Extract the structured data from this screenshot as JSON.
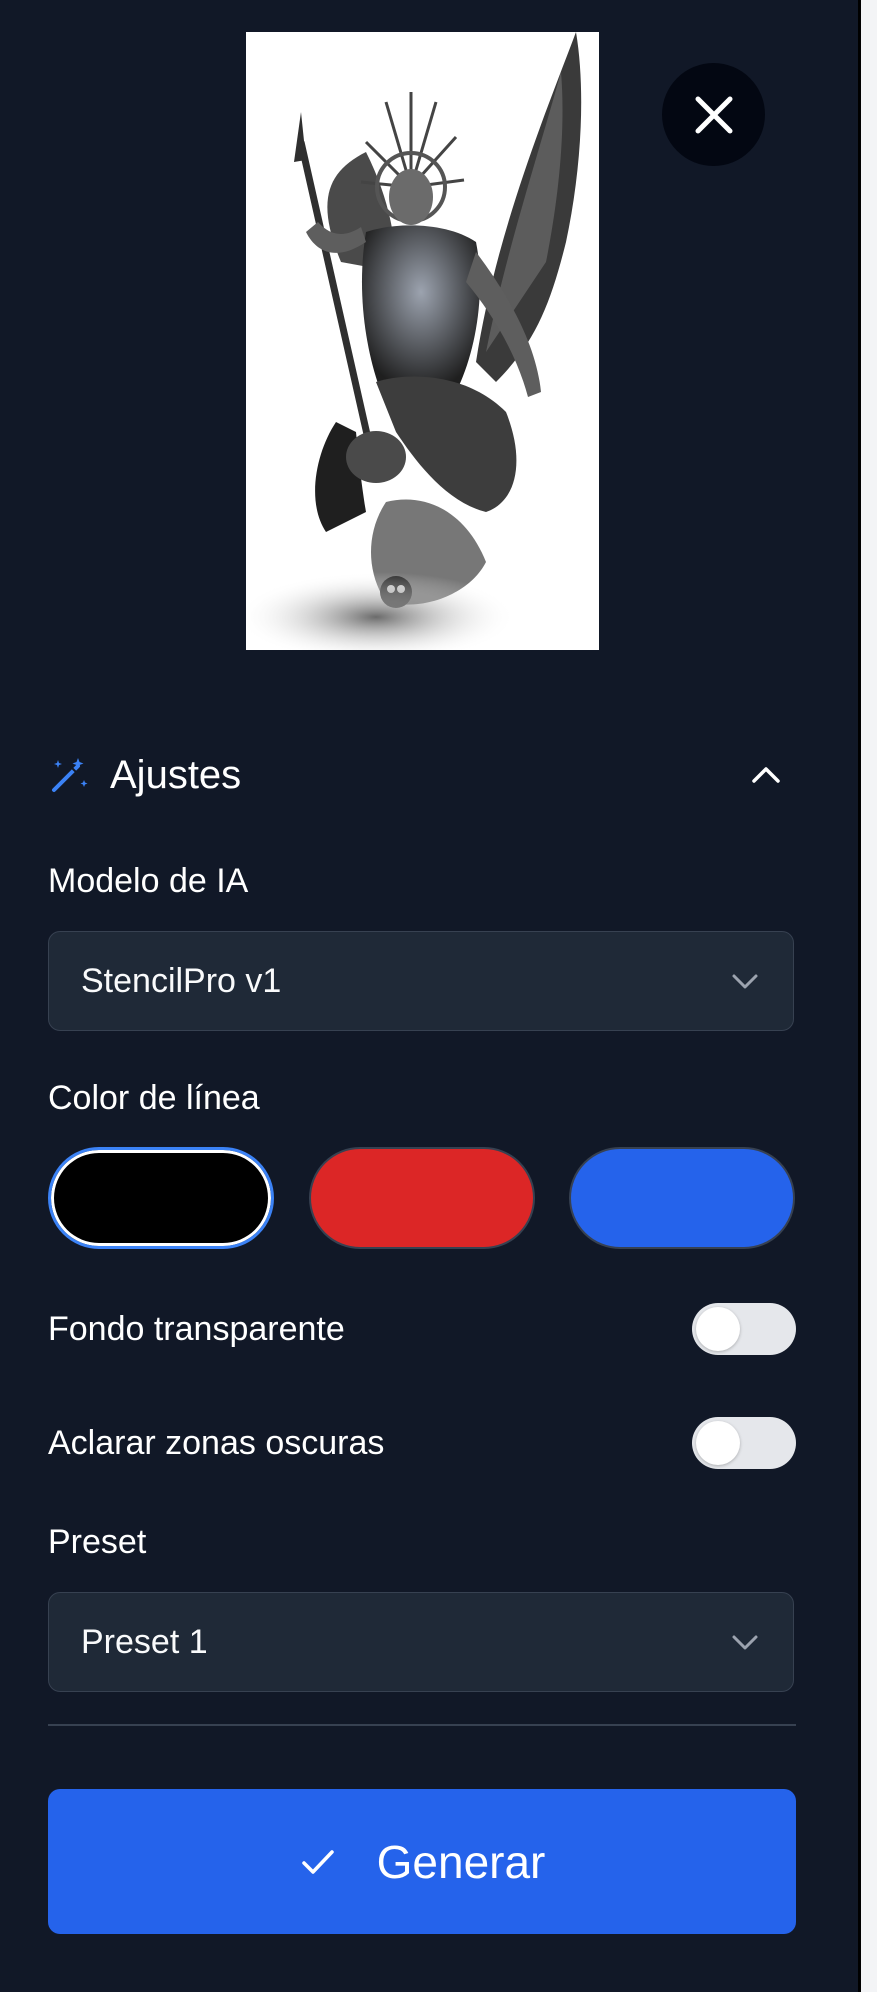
{
  "settings": {
    "title": "Ajustes",
    "model_label": "Modelo de IA",
    "model_value": "StencilPro v1",
    "line_color_label": "Color de línea",
    "line_colors": [
      {
        "name": "black",
        "hex": "#000000",
        "selected": true
      },
      {
        "name": "red",
        "hex": "#dc2626",
        "selected": false
      },
      {
        "name": "blue",
        "hex": "#2563eb",
        "selected": false
      }
    ],
    "transparent_bg_label": "Fondo transparente",
    "transparent_bg_on": false,
    "lighten_dark_label": "Aclarar zonas oscuras",
    "lighten_dark_on": false,
    "preset_label": "Preset",
    "preset_value": "Preset 1",
    "generate_label": "Generar"
  },
  "icons": {
    "close": "close-icon",
    "settings": "magic-wand-icon",
    "collapse": "chevron-up-icon",
    "dropdown": "chevron-down-icon",
    "confirm": "check-icon"
  },
  "colors": {
    "background": "#111827",
    "accent": "#2563eb",
    "field": "#1f2937"
  }
}
